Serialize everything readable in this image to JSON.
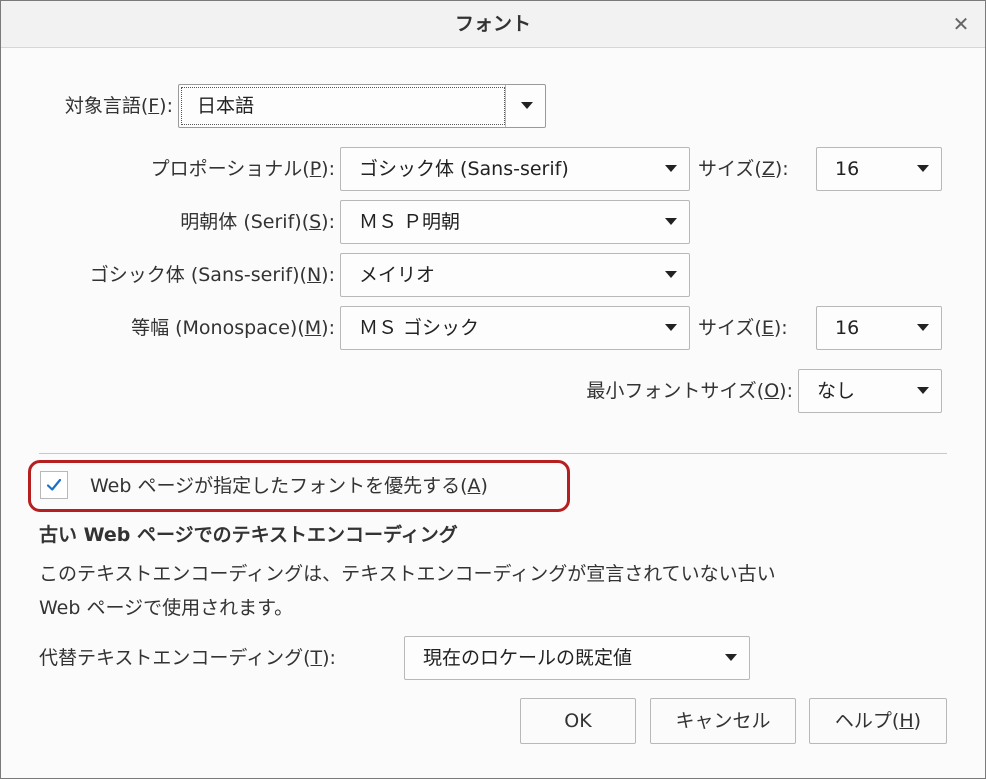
{
  "window": {
    "title": "フォント"
  },
  "language": {
    "label_pre": "対象言語(",
    "label_key": "F",
    "label_post": "):",
    "value": "日本語"
  },
  "proportional": {
    "label_pre": "プロポーショナル(",
    "label_key": "P",
    "label_post": "):",
    "value": "ゴシック体 (Sans-serif)"
  },
  "proportional_size": {
    "label_pre": "サイズ(",
    "label_key": "Z",
    "label_post": "):",
    "value": "16"
  },
  "serif": {
    "label_pre": "明朝体 (Serif)(",
    "label_key": "S",
    "label_post": "):",
    "value": "ＭＳ Ｐ明朝"
  },
  "sans": {
    "label_pre": "ゴシック体 (Sans-serif)(",
    "label_key": "N",
    "label_post": "):",
    "value": "メイリオ"
  },
  "mono": {
    "label_pre": "等幅 (Monospace)(",
    "label_key": "M",
    "label_post": "):",
    "value": "ＭＳ ゴシック"
  },
  "mono_size": {
    "label_pre": "サイズ(",
    "label_key": "E",
    "label_post": "):",
    "value": "16"
  },
  "min_size": {
    "label_pre": "最小フォントサイズ(",
    "label_key": "O",
    "label_post": "):",
    "value": "なし"
  },
  "allow_page_fonts": {
    "label_pre": "Web ページが指定したフォントを優先する(",
    "label_key": "A",
    "label_post": ")",
    "checked": true
  },
  "legacy": {
    "title": "古い Web ページでのテキストエンコーディング",
    "desc_line1": "このテキストエンコーディングは、テキストエンコーディングが宣言されていない古い",
    "desc_line2": "Web ページで使用されます。",
    "fallback_label_pre": "代替テキストエンコーディング(",
    "fallback_label_key": "T",
    "fallback_label_post": "):",
    "fallback_value": "現在のロケールの既定値"
  },
  "buttons": {
    "ok": "OK",
    "cancel": "キャンセル",
    "help_pre": "ヘルプ(",
    "help_key": "H",
    "help_post": ")"
  },
  "colors": {
    "highlight_frame": "#b51f1f",
    "checkmark": "#1c6fc9"
  }
}
